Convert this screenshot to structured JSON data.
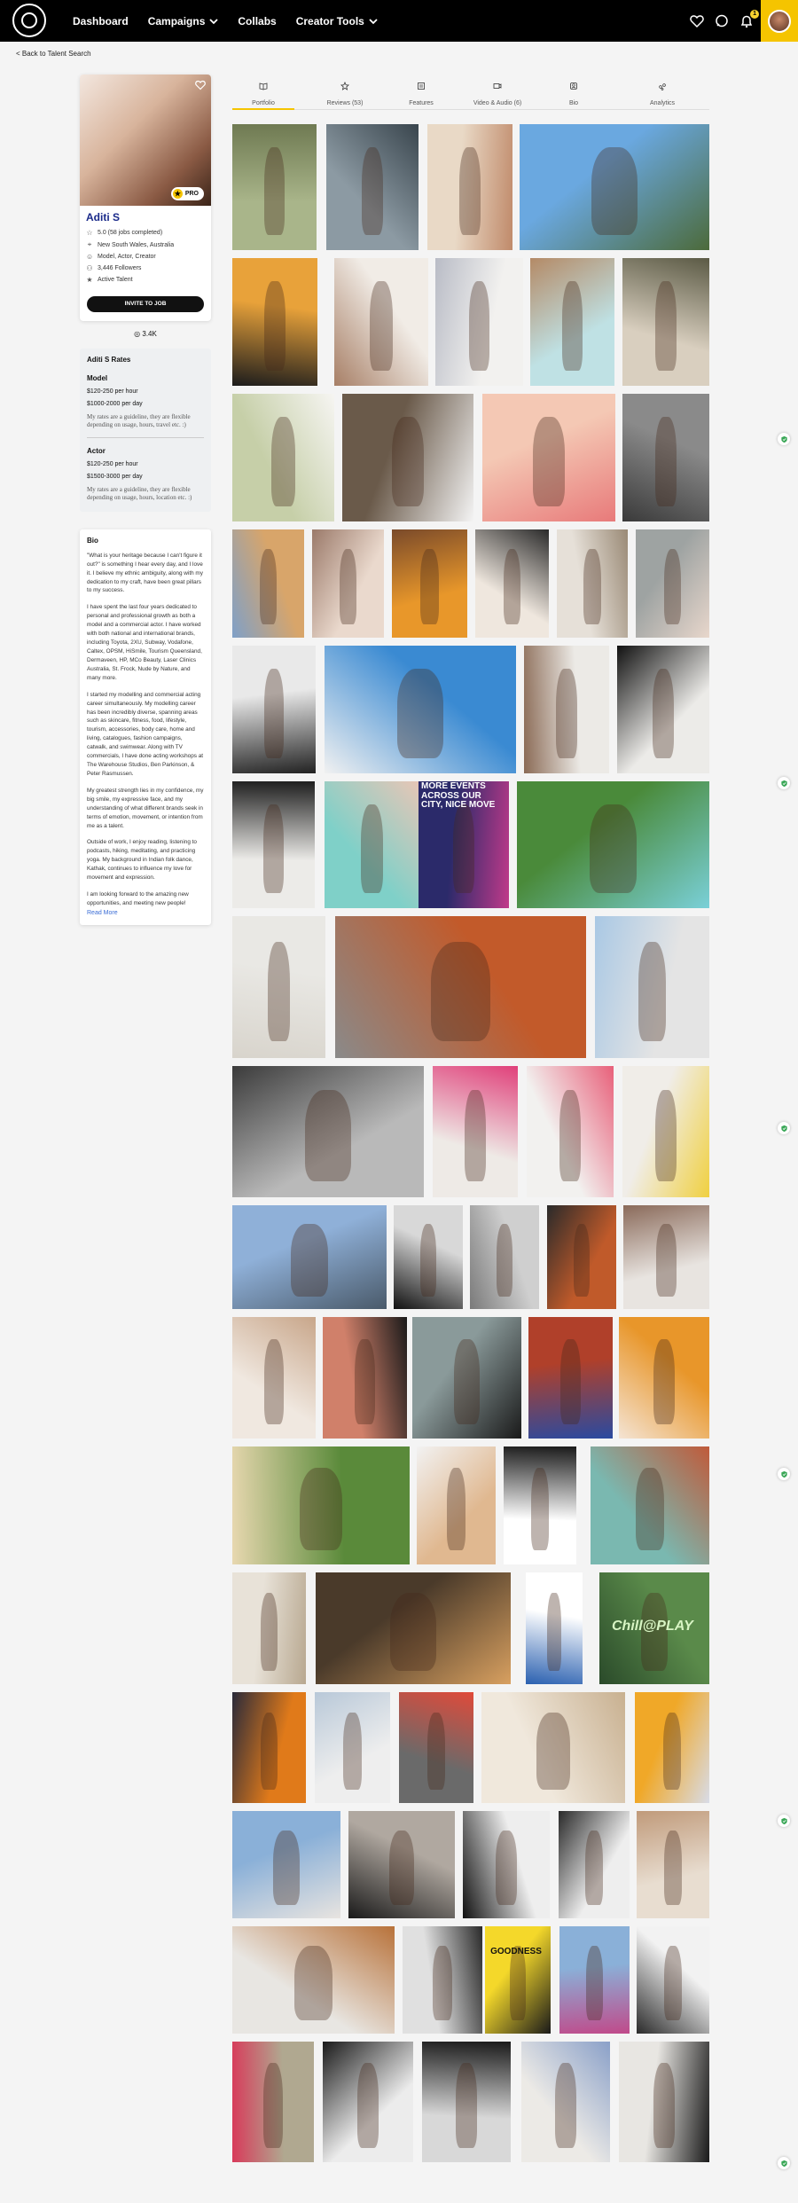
{
  "nav": {
    "logo_text": "THE",
    "links": [
      {
        "label": "Dashboard",
        "caret": false
      },
      {
        "label": "Campaigns",
        "caret": true
      },
      {
        "label": "Collabs",
        "caret": false
      },
      {
        "label": "Creator Tools",
        "caret": true
      }
    ],
    "notification_count": "1",
    "icons": [
      "heart-icon",
      "chat-icon",
      "bell-icon"
    ]
  },
  "back_link": "< Back to Talent Search",
  "profile": {
    "name": "Aditi S",
    "pro_label": "PRO",
    "rating": "5.0 (58 jobs completed)",
    "location": "New South Wales, Australia",
    "roles": "Model, Actor, Creator",
    "followers": "3,446 Followers",
    "status": "Active Talent",
    "invite_button": "INVITE TO JOB",
    "instagram": "3.4K"
  },
  "rates": {
    "title": "Aditi S Rates",
    "model": {
      "heading": "Model",
      "hourly": "$120-250 per hour",
      "daily": "$1000-2000 per day",
      "note": "My rates are a guideline, they are flexible depending on usage, hours, travel etc. :)"
    },
    "actor": {
      "heading": "Actor",
      "hourly": "$120-250 per hour",
      "daily": "$1500-3000 per day",
      "note": "My rates are a guideline, they are flexible depending on usage, hours, location etc. :)"
    }
  },
  "bio": {
    "title": "Bio",
    "paragraphs": [
      "\"What is your heritage because I can't figure it out?\" is something I hear every day, and I love it. I believe my ethnic ambiguity, along with my dedication to my craft, have been great pillars to my success.",
      "I have spent the last four years dedicated to personal and professional growth as both a model and a commercial actor. I have worked with both national and international brands, including Toyota, 2XU, Subway, Vodafone, Caltex, OPSM, HiSmile, Tourism Queensland, Dermaveen, HP, MCo Beauty, Laser Clinics Australia, St. Frock, Nude by Nature, and many more.",
      "I started my modelling and commercial acting career simultaneously. My modelling career has been incredibly diverse, spanning areas such as skincare, fitness, food, lifestyle, tourism, accessories, body care, home and living, catalogues, fashion campaigns, catwalk, and swimwear. Along with TV commercials, I have done acting workshops at The Warehouse Studios, Ben Parkinson, & Peter Rasmussen.",
      "My greatest strength lies in my confidence, my big smile, my expressive face, and my understanding of what different brands seek in terms of emotion, movement, or intention from me as a talent.",
      "Outside of work, I enjoy reading, listening to podcasts, hiking, meditating, and practicing yoga. My background in Indian folk dance, Kathak, continues to influence my love for movement and expression.",
      "I am looking forward to the amazing new opportunities, and meeting new people!"
    ],
    "read_more": "Read More"
  },
  "tabs": [
    {
      "label": "Portfolio",
      "icon": "book-icon",
      "active": true
    },
    {
      "label": "Reviews (53)",
      "icon": "star-icon",
      "active": false
    },
    {
      "label": "Features",
      "icon": "newspaper-icon",
      "active": false
    },
    {
      "label": "Video & Audio (6)",
      "icon": "video-icon",
      "active": false
    },
    {
      "label": "Bio",
      "icon": "person-icon",
      "active": false
    },
    {
      "label": "Analytics",
      "icon": "analytics-icon",
      "active": false
    }
  ],
  "portfolio_overlay_text": {
    "events_poster": "MORE EVENTS ACROSS OUR CITY, NICE MOVE",
    "chill_poster": "Chill@PLAY",
    "goodness_poster": "GOODNESS"
  },
  "colors": {
    "nav_bg": "#000000",
    "accent": "#f5c400",
    "name_blue": "#1a2a8a",
    "check_green": "#3aa757"
  }
}
